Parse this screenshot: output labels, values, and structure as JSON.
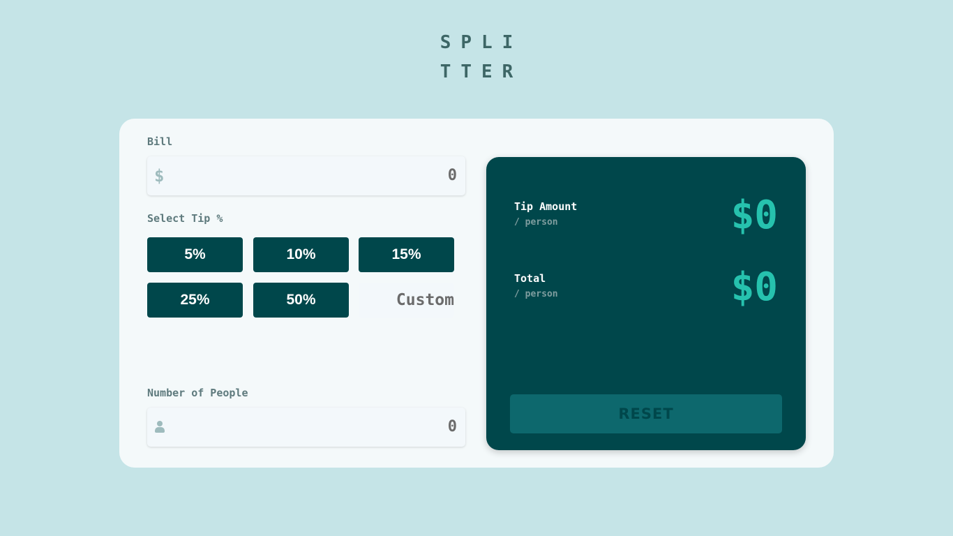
{
  "app": {
    "logo_line1": "SPLI",
    "logo_line2": "TTER"
  },
  "bill": {
    "label": "Bill",
    "currency_icon": "dollar-icon",
    "currency_symbol": "$",
    "value": "0"
  },
  "tip": {
    "label": "Select Tip %",
    "options": [
      "5%",
      "10%",
      "15%",
      "25%",
      "50%"
    ],
    "custom_placeholder": "Custom"
  },
  "people": {
    "label": "Number of People",
    "icon": "person-icon",
    "value": "0"
  },
  "results": {
    "tip_amount_label": "Tip Amount",
    "tip_amount_sub": "/ person",
    "tip_amount_value": "$0",
    "total_label": "Total",
    "total_sub": "/ person",
    "total_value": "$0",
    "reset_label": "RESET"
  },
  "colors": {
    "background": "#c5e4e7",
    "card": "#f4f9fa",
    "panel": "#00474b",
    "accent": "#26c2ae",
    "reset_button": "#0d686d"
  }
}
